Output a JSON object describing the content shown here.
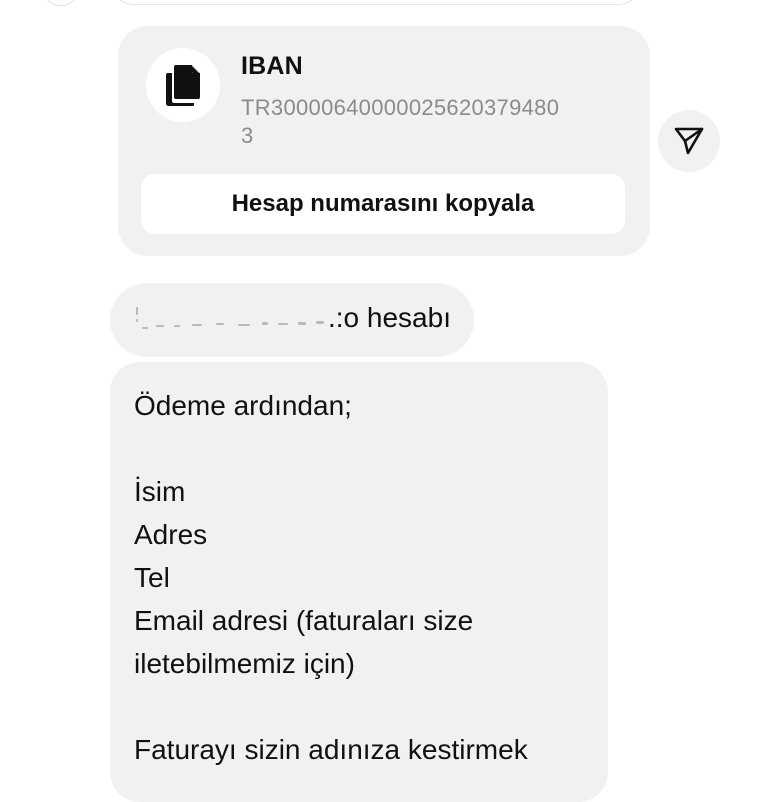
{
  "iban_card": {
    "title": "IBAN",
    "number_line1": "TR30000640000025620379480",
    "number_line2": "3",
    "copy_button_label": "Hesap numarasını kopyala",
    "doc_icon": "copy-document-icon"
  },
  "share_button": {
    "icon": "send-paper-plane-icon"
  },
  "short_message": {
    "visible_text": ".:o hesabı"
  },
  "long_message": {
    "line1": "Ödeme ardından;",
    "line2": "İsim",
    "line3": "Adres",
    "line4": "Tel",
    "line5": "Email adresi (faturaları size",
    "line6": "iletebilmemiz için)",
    "line7": "Faturayı sizin adınıza kestirmek"
  },
  "colors": {
    "bubble_bg": "#f1f1f4",
    "text_primary": "#111111",
    "text_secondary": "#8a8a8f",
    "button_bg": "#ffffff"
  }
}
